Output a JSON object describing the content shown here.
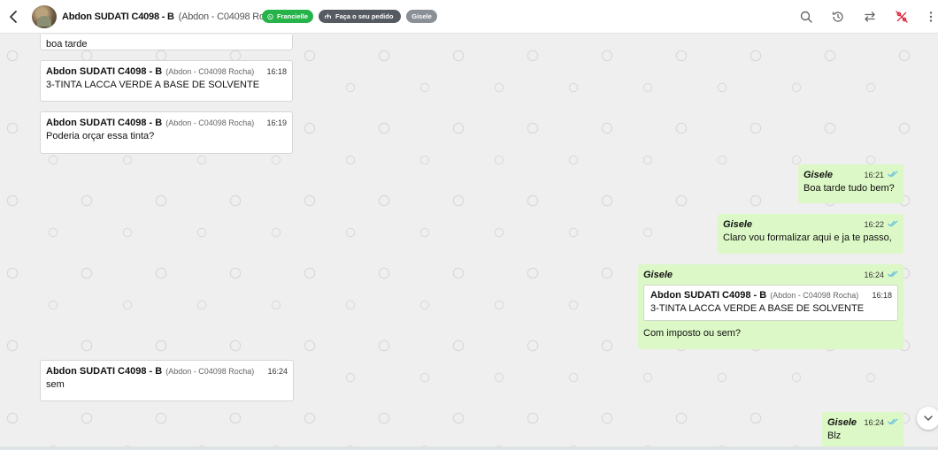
{
  "header": {
    "contact_name": "Abdon SUDATI C4098 - B",
    "contact_sub": "(Abdon - C04098 Rocha)",
    "tags": {
      "whatsapp": "Francielle",
      "order": "Faça o seu pedido",
      "agent": "Gisele"
    },
    "icons": [
      "back-icon",
      "search-icon",
      "history-icon",
      "transfer-icon",
      "percent-off-icon",
      "more-vert-icon"
    ]
  },
  "colors": {
    "incoming_bubble": "#ffffff",
    "outgoing_bubble": "#dcf8c6",
    "whatsapp_tag": "#25b34a",
    "order_tag": "#555b61",
    "agent_tag": "#8a9096",
    "percent_icon": "#e0263b",
    "read_ticks": "#4fb3e0"
  },
  "messages": [
    {
      "direction": "in",
      "text": "boa tarde"
    },
    {
      "direction": "in",
      "author": "Abdon SUDATI C4098 - B",
      "sub": "(Abdon - C04098 Rocha)",
      "time": "16:18",
      "text": "3-TINTA LACCA VERDE A BASE DE SOLVENTE"
    },
    {
      "direction": "in",
      "author": "Abdon SUDATI C4098 - B",
      "sub": "(Abdon - C04098 Rocha)",
      "time": "16:19",
      "text": "Poderia orçar essa tinta?"
    },
    {
      "direction": "out",
      "author": "Gisele",
      "time": "16:21",
      "text": "Boa tarde tudo bem?"
    },
    {
      "direction": "out",
      "author": "Gisele",
      "time": "16:22",
      "text": "Claro vou formalizar aqui e ja te passo,"
    },
    {
      "direction": "out",
      "author": "Gisele",
      "time": "16:24",
      "quote": {
        "author": "Abdon SUDATI C4098 - B",
        "sub": "(Abdon - C04098 Rocha)",
        "time": "16:18",
        "text": "3-TINTA LACCA VERDE A BASE DE SOLVENTE"
      },
      "text": "Com imposto ou sem?"
    },
    {
      "direction": "in",
      "author": "Abdon SUDATI C4098 - B",
      "sub": "(Abdon - C04098 Rocha)",
      "time": "16:24",
      "text": "sem"
    },
    {
      "direction": "out",
      "author": "Gisele",
      "time": "16:24",
      "text": "Blz"
    }
  ]
}
